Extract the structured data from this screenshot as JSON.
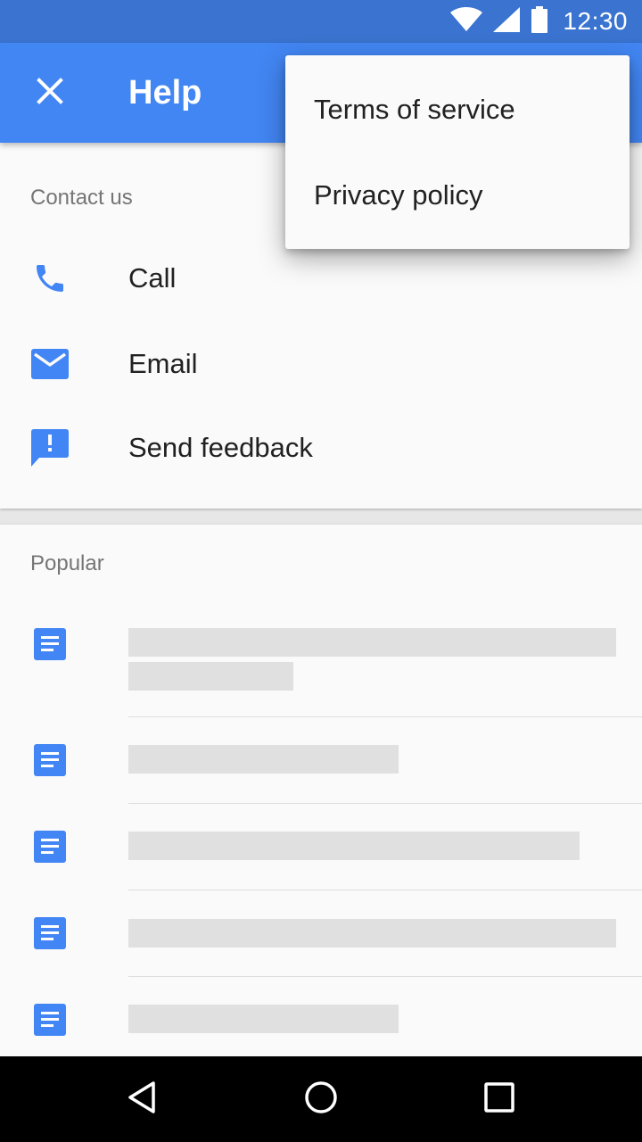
{
  "status_bar": {
    "time": "12:30",
    "icons": [
      "wifi-icon",
      "cell-signal-icon",
      "battery-icon"
    ]
  },
  "app_bar": {
    "title": "Help",
    "close_icon": "close-icon"
  },
  "contact": {
    "header": "Contact us",
    "items": [
      {
        "label": "Call",
        "icon": "phone-icon"
      },
      {
        "label": "Email",
        "icon": "email-icon"
      },
      {
        "label": "Send feedback",
        "icon": "feedback-icon"
      }
    ]
  },
  "popular": {
    "header": "Popular",
    "article_icon": "document-icon",
    "article_count": 5
  },
  "overflow_menu": {
    "items": [
      {
        "label": "Terms of service"
      },
      {
        "label": "Privacy policy"
      }
    ]
  },
  "nav_bar": {
    "buttons": [
      "back-icon",
      "home-icon",
      "recents-icon"
    ]
  },
  "colors": {
    "status_bar": "#3a74d0",
    "app_bar": "#4286f3",
    "icon_accent": "#4285f4",
    "placeholder": "#e0e0e0"
  }
}
